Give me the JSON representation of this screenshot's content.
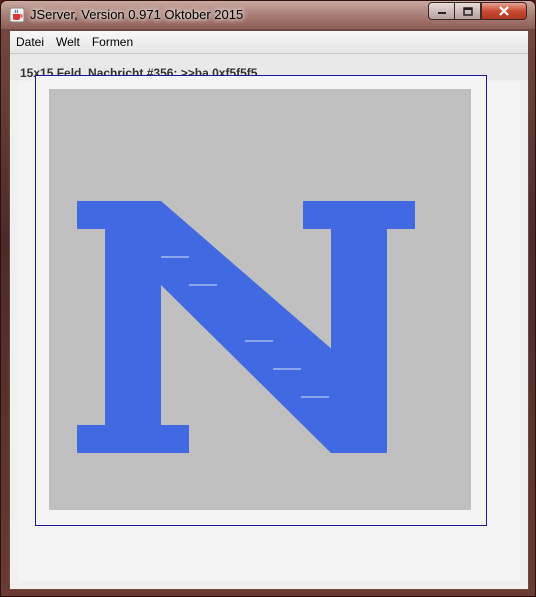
{
  "window": {
    "title": "JServer, Version 0.971 Oktober 2015"
  },
  "menu": {
    "items": [
      "Datei",
      "Welt",
      "Formen"
    ]
  },
  "status": {
    "text": "15x15 Feld, Nachricht #356: >>ba 0xf5f5f5"
  },
  "board": {
    "grid": "15x15",
    "background_color": "#c0c0c0",
    "shape_color": "#4169e1",
    "shape": "letter-N"
  },
  "colors": {
    "frame_border": "#1a1a9a",
    "close_button": "#c84a33"
  },
  "icons": {
    "app": "java-cup-icon",
    "minimize": "minimize-icon",
    "maximize": "maximize-icon",
    "close": "close-icon"
  }
}
